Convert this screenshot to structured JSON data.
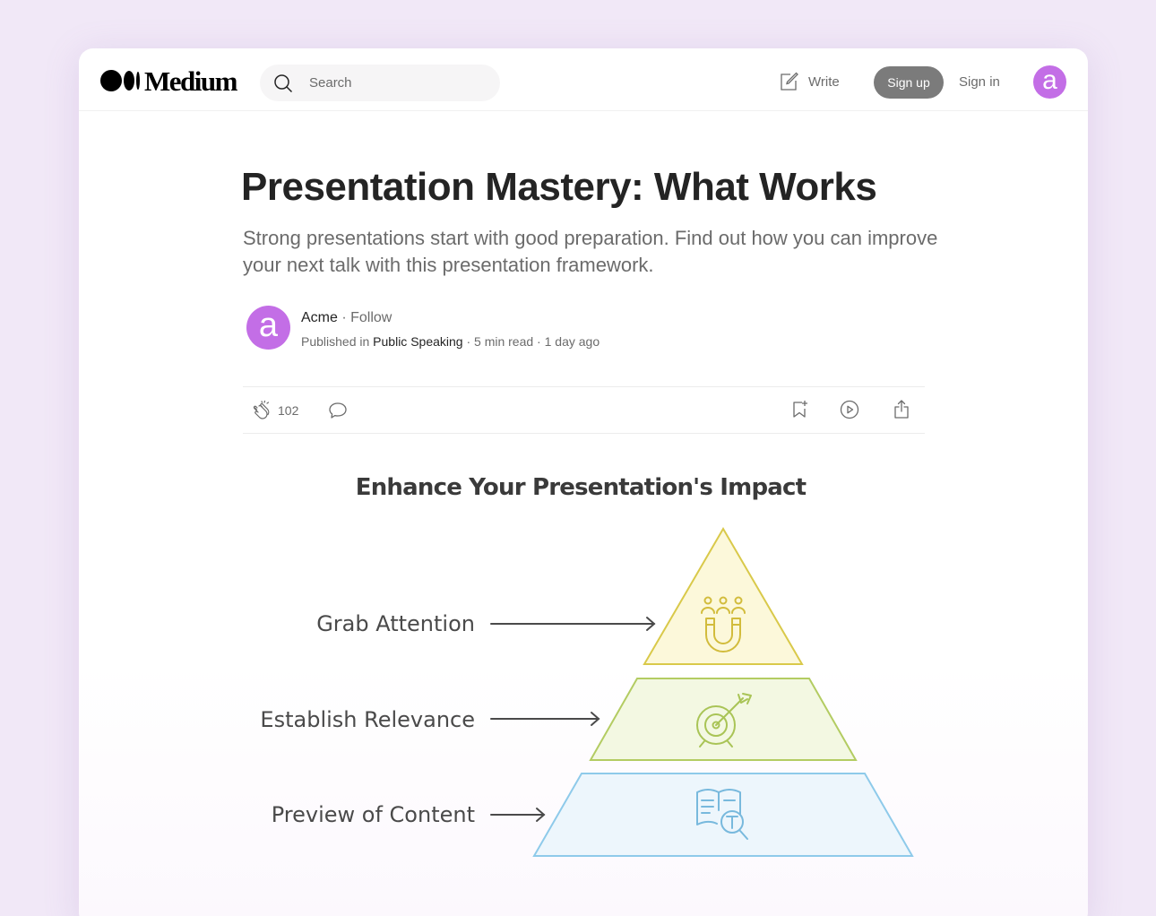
{
  "app": {
    "logo_text": "Medium"
  },
  "header": {
    "search_placeholder": "Search",
    "write_label": "Write",
    "signup_label": "Sign up",
    "signin_label": "Sign in",
    "avatar_letter": "a"
  },
  "article": {
    "title": "Presentation Mastery: What Works",
    "subtitle": "Strong presentations start with good preparation. Find out how you can improve your next talk with this presentation framework.",
    "author": {
      "avatar_letter": "a",
      "name": "Acme",
      "separator": " · ",
      "follow": "Follow",
      "published_prefix": "Published in ",
      "publication": "Public Speaking",
      "meta": " · 5 min read · 1 day ago"
    },
    "actions": {
      "clap_count": "102"
    }
  },
  "diagram": {
    "title": "Enhance Your Presentation's Impact",
    "levels": [
      {
        "label": "Grab Attention",
        "icon": "magnet-audience-icon",
        "color": "#d9c94a"
      },
      {
        "label": "Establish Relevance",
        "icon": "target-arrow-icon",
        "color": "#b3cc62"
      },
      {
        "label": "Preview of Content",
        "icon": "book-search-icon",
        "color": "#8ecaea"
      }
    ]
  },
  "colors": {
    "accent": "#c36ee6",
    "background": "#f1e8f7"
  }
}
